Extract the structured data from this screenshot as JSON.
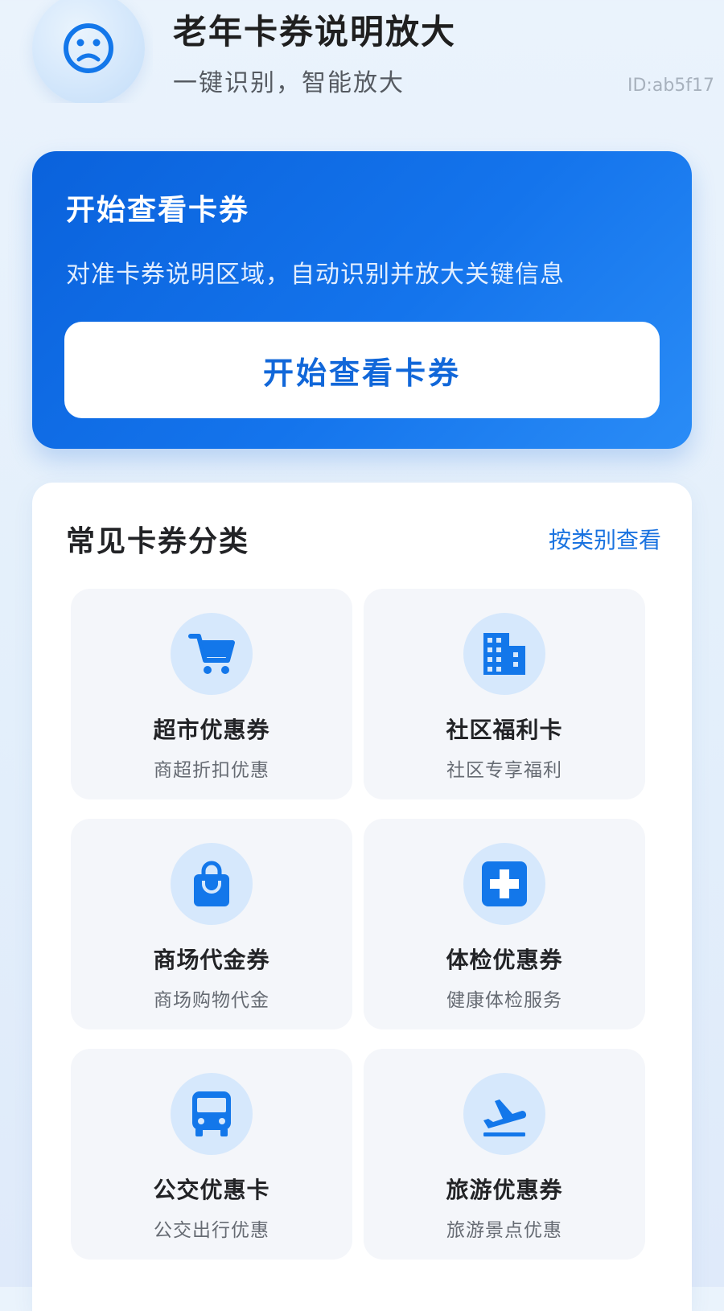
{
  "header": {
    "title": "老年卡券说明放大",
    "subtitle": "一键识别，智能放大",
    "id_label": "ID:ab5f17",
    "avatar_icon": "sad-face-icon"
  },
  "hero": {
    "title": "开始查看卡券",
    "description": "对准卡券说明区域，自动识别并放大关键信息",
    "button_label": "开始查看卡券"
  },
  "categories": {
    "title": "常见卡券分类",
    "link_label": "按类别查看",
    "items": [
      {
        "name": "超市优惠券",
        "desc": "商超折扣优惠",
        "icon": "shopping-cart-icon"
      },
      {
        "name": "社区福利卡",
        "desc": "社区专享福利",
        "icon": "building-icon"
      },
      {
        "name": "商场代金券",
        "desc": "商场购物代金",
        "icon": "shopping-bag-icon"
      },
      {
        "name": "体检优惠券",
        "desc": "健康体检服务",
        "icon": "medical-cross-icon"
      },
      {
        "name": "公交优惠卡",
        "desc": "公交出行优惠",
        "icon": "bus-icon"
      },
      {
        "name": "旅游优惠券",
        "desc": "旅游景点优惠",
        "icon": "airplane-departure-icon"
      }
    ]
  },
  "colors": {
    "accent": "#1a73e0",
    "hero_start": "#0a62dc",
    "hero_end": "#2a8cf6",
    "icon_bg": "#d6e8fc",
    "tile_bg": "#f4f6fa"
  }
}
